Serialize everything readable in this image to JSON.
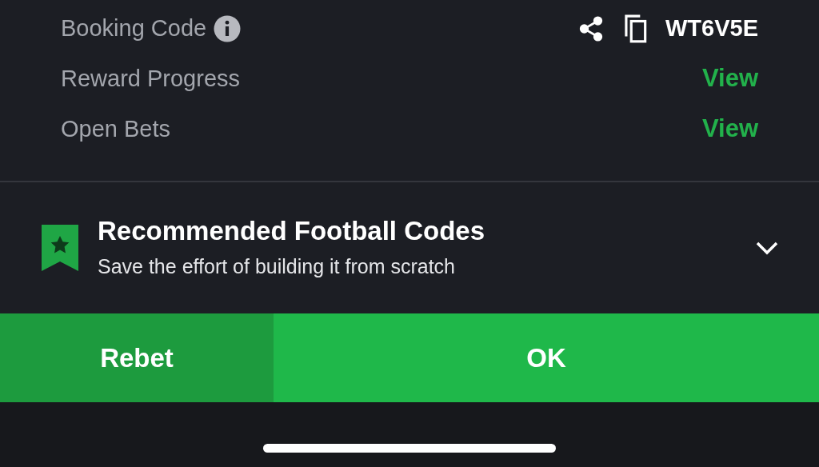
{
  "details": [
    {
      "kind": "code",
      "label": "Booking Code",
      "value": "WT6V5E"
    },
    {
      "kind": "link",
      "label": "Reward Progress",
      "value": "View"
    },
    {
      "kind": "link",
      "label": "Open Bets",
      "value": "View"
    }
  ],
  "recommended": {
    "title": "Recommended Football Codes",
    "subtitle": "Save the effort of building it from scratch",
    "expanded": false
  },
  "buttons": [
    {
      "label": "Rebet",
      "kind": "secondary"
    },
    {
      "label": "OK",
      "kind": "primary"
    }
  ]
}
